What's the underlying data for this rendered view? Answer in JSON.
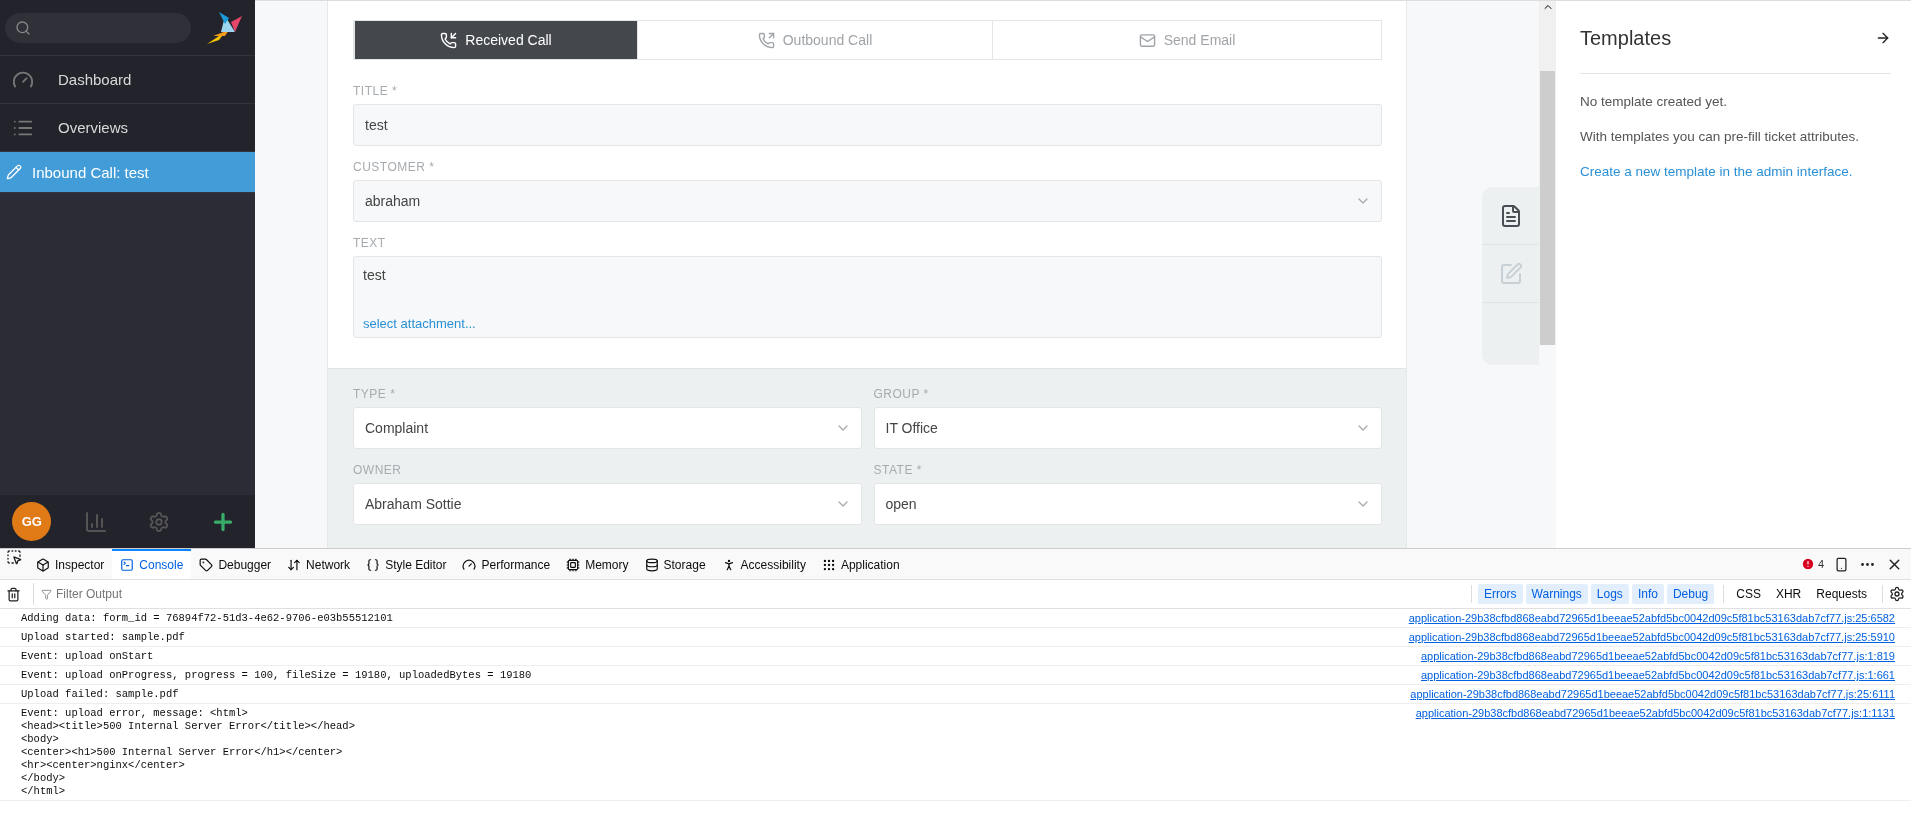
{
  "sidebar": {
    "nav": [
      {
        "label": "Dashboard",
        "selected": false
      },
      {
        "label": "Overviews",
        "selected": false
      },
      {
        "label": "Inbound Call: test",
        "selected": true
      }
    ],
    "avatar": "GG"
  },
  "ticket_form": {
    "tabs": [
      {
        "label": "Received Call",
        "selected": true
      },
      {
        "label": "Outbound Call",
        "selected": false
      },
      {
        "label": "Send Email",
        "selected": false
      }
    ],
    "fields": [
      {
        "kind": "input",
        "label": "TITLE *",
        "value": "test"
      },
      {
        "kind": "select",
        "label": "CUSTOMER *",
        "value": "abraham"
      },
      {
        "kind": "textarea",
        "label": "TEXT",
        "value": "test",
        "link": "select attachment..."
      }
    ],
    "attributes": [
      {
        "label": "TYPE *",
        "value": "Complaint"
      },
      {
        "label": "GROUP *",
        "value": "IT Office"
      },
      {
        "label": "OWNER",
        "value": "Abraham Sottie"
      },
      {
        "label": "STATE *",
        "value": "open"
      }
    ]
  },
  "side_tabs": [
    {
      "selected": true
    },
    {
      "selected": false
    }
  ],
  "templates": {
    "title": "Templates",
    "messages": [
      "No template created yet.",
      "With templates you can pre-fill ticket attributes."
    ],
    "link": "Create a new template in the admin interface."
  },
  "devtools": {
    "tabs": [
      {
        "label": "Inspector",
        "selected": false
      },
      {
        "label": "Console",
        "selected": true
      },
      {
        "label": "Debugger",
        "selected": false
      },
      {
        "label": "Network",
        "selected": false
      },
      {
        "label": "Style Editor",
        "selected": false
      },
      {
        "label": "Performance",
        "selected": false
      },
      {
        "label": "Memory",
        "selected": false
      },
      {
        "label": "Storage",
        "selected": false
      },
      {
        "label": "Accessibility",
        "selected": false
      },
      {
        "label": "Application",
        "selected": false
      }
    ],
    "error_count": "4",
    "filter": {
      "placeholder": "Filter Output"
    },
    "level_filters": [
      {
        "label": "Errors",
        "on": true
      },
      {
        "label": "Warnings",
        "on": true
      },
      {
        "label": "Logs",
        "on": true
      },
      {
        "label": "Info",
        "on": true
      },
      {
        "label": "Debug",
        "on": true
      }
    ],
    "type_filters": [
      {
        "label": "CSS",
        "on": false
      },
      {
        "label": "XHR",
        "on": false
      },
      {
        "label": "Requests",
        "on": false
      }
    ],
    "messages": [
      {
        "text": "Adding data: form_id = 76894f72-51d3-4e62-9706-e03b55512101",
        "source": "application-29b38cfbd868eabd72965d1beeae52abfd5bc0042d09c5f81bc53163dab7cf77.js:25:6582"
      },
      {
        "text": "Upload started: sample.pdf",
        "source": "application-29b38cfbd868eabd72965d1beeae52abfd5bc0042d09c5f81bc53163dab7cf77.js:25:5910"
      },
      {
        "text": "Event: upload onStart",
        "source": "application-29b38cfbd868eabd72965d1beeae52abfd5bc0042d09c5f81bc53163dab7cf77.js:1:819"
      },
      {
        "text": "Event: upload onProgress, progress = 100, fileSize = 19180, uploadedBytes = 19180",
        "source": "application-29b38cfbd868eabd72965d1beeae52abfd5bc0042d09c5f81bc53163dab7cf77.js:1:661"
      },
      {
        "text": "Upload failed: sample.pdf",
        "source": "application-29b38cfbd868eabd72965d1beeae52abfd5bc0042d09c5f81bc53163dab7cf77.js:25:6111"
      },
      {
        "text": "Event: upload error, message: <html>\n<head><title>500 Internal Server Error</title></head>\n<body>\n<center><h1>500 Internal Server Error</h1></center>\n<hr><center>nginx</center>\n</body>\n</html>",
        "source": "application-29b38cfbd868eabd72965d1beeae52abfd5bc0042d09c5f81bc53163dab7cf77.js:1:1131"
      }
    ]
  }
}
